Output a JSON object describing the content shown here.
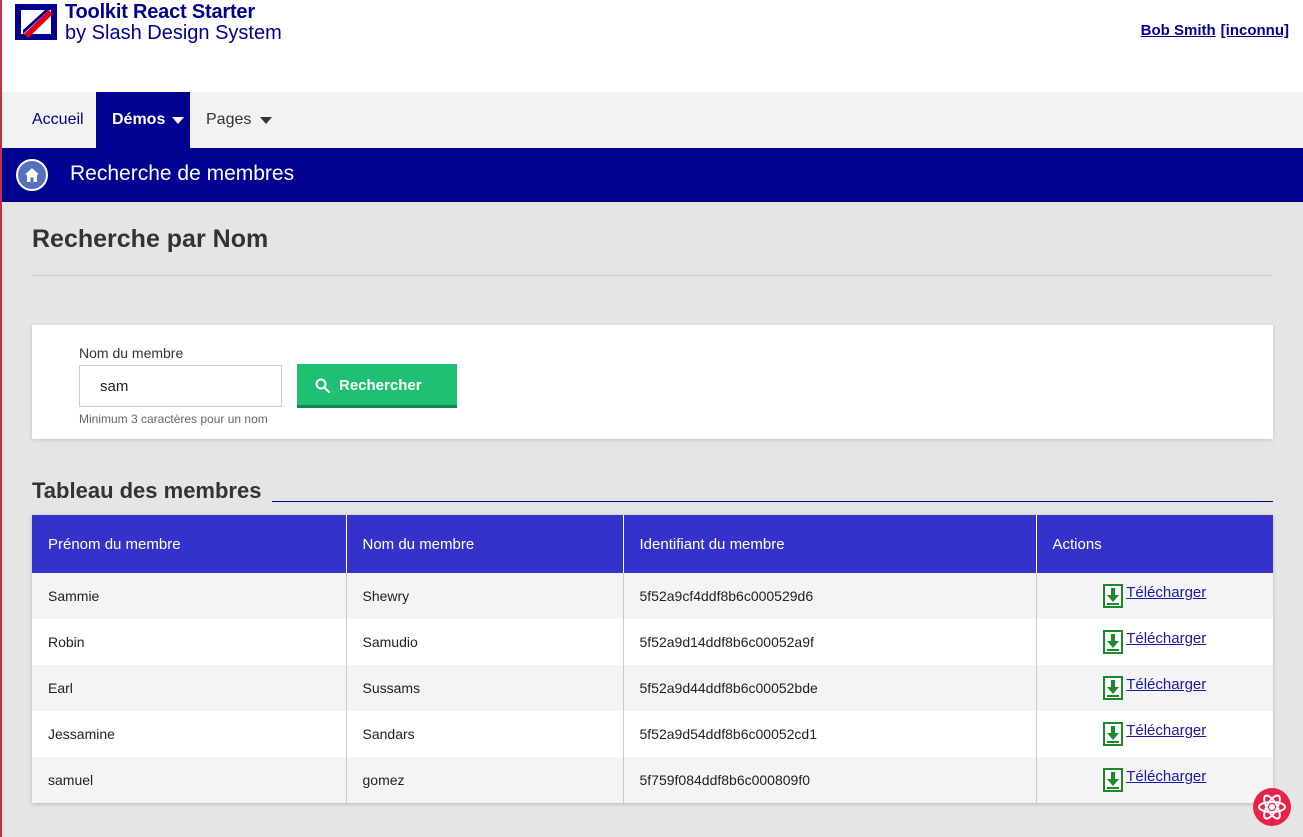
{
  "header": {
    "brand_title": "Toolkit React Starter",
    "brand_subtitle": "by Slash Design System",
    "user_name": "Bob Smith",
    "user_role": "[inconnu]"
  },
  "nav": {
    "items": [
      {
        "label": "Accueil",
        "active": false,
        "dropdown": false
      },
      {
        "label": "Démos",
        "active": true,
        "dropdown": true
      },
      {
        "label": "Pages",
        "active": false,
        "dropdown": true
      }
    ]
  },
  "banner": {
    "icon": "home-icon",
    "title": "Recherche de membres"
  },
  "page": {
    "title": "Recherche par Nom"
  },
  "search": {
    "label": "Nom du membre",
    "value": "sam",
    "hint": "Minimum 3 caractères pour un nom",
    "button_label": "Rechercher",
    "button_icon": "search-icon"
  },
  "table": {
    "title": "Tableau des membres",
    "columns": [
      "Prénom du membre",
      "Nom du membre",
      "Identifiant du membre",
      "Actions"
    ],
    "rows": [
      {
        "first": "Sammie",
        "last": "Shewry",
        "id": "5f52a9cf4ddf8b6c000529d6",
        "action": "Télécharger"
      },
      {
        "first": "Robin",
        "last": "Samudio",
        "id": "5f52a9d14ddf8b6c00052a9f",
        "action": "Télécharger"
      },
      {
        "first": "Earl",
        "last": "Sussams",
        "id": "5f52a9d44ddf8b6c00052bde",
        "action": "Télécharger"
      },
      {
        "first": "Jessamine",
        "last": "Sandars",
        "id": "5f52a9d54ddf8b6c00052cd1",
        "action": "Télécharger"
      },
      {
        "first": "samuel",
        "last": "gomez",
        "id": "5f759f084ddf8b6c000809f0",
        "action": "Télécharger"
      }
    ]
  },
  "colors": {
    "primary": "#000091",
    "table_header": "#3333cc",
    "success": "#1fc074"
  }
}
